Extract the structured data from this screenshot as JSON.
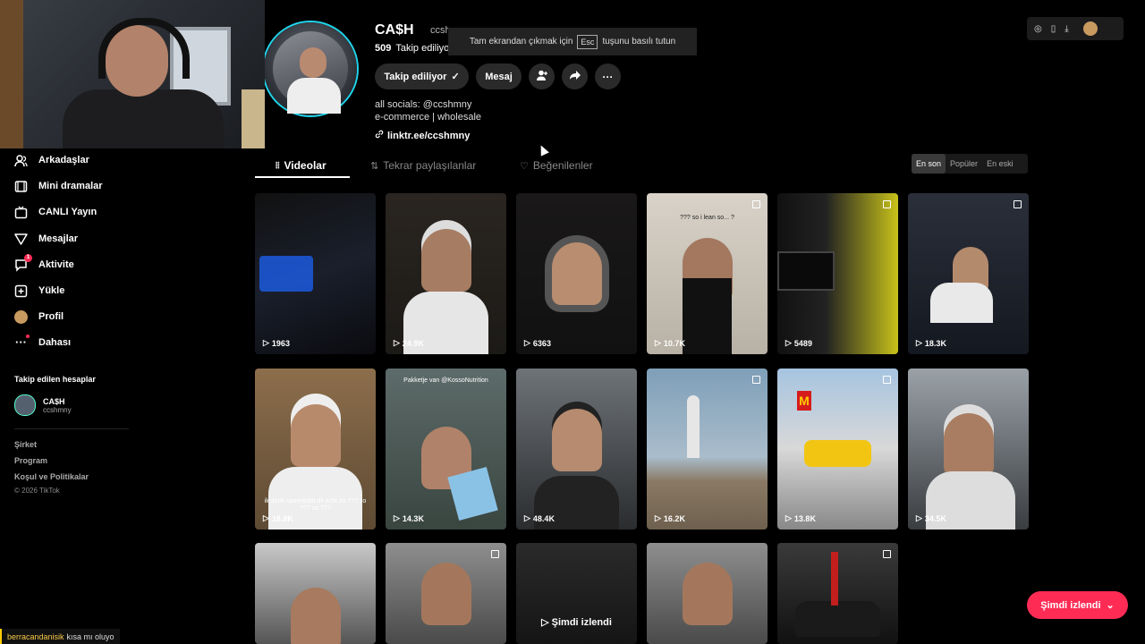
{
  "profile": {
    "name": "CA$H",
    "handle": "ccsh",
    "following_count": "509",
    "following_label": "Takip ediliyo",
    "buttons": {
      "following": "Takip ediliyor",
      "message": "Mesaj"
    },
    "bio_line1": "all socials: @ccshmny",
    "bio_line2": "e-commerce | wholesale",
    "link": "linktr.ee/ccshmny"
  },
  "toast": {
    "before": "Tam ekrandan çıkmak için",
    "key": "Esc",
    "after": "tuşunu basılı tutun"
  },
  "sidebar": {
    "items": [
      {
        "label": "Arkadaşlar",
        "icon": "friends-icon"
      },
      {
        "label": "Mini dramalar",
        "icon": "mini-drama-icon"
      },
      {
        "label": "CANLI Yayın",
        "icon": "live-icon"
      },
      {
        "label": "Mesajlar",
        "icon": "messages-icon"
      },
      {
        "label": "Aktivite",
        "icon": "activity-icon",
        "badge": "1"
      },
      {
        "label": "Yükle",
        "icon": "upload-icon"
      },
      {
        "label": "Profil",
        "icon": "profile-icon"
      },
      {
        "label": "Dahası",
        "icon": "more-icon"
      }
    ],
    "following_title": "Takip edilen hesaplar",
    "account": {
      "name": "CA$H",
      "handle": "ccshmny"
    },
    "footer": [
      "Şirket",
      "Program",
      "Koşul ve Politikalar"
    ],
    "copyright": "© 2026 TikTok"
  },
  "tabs": [
    {
      "label": "Videolar",
      "icon": "grid-icon"
    },
    {
      "label": "Tekrar paylaşılanlar",
      "icon": "repost-icon"
    },
    {
      "label": "Beğenilenler",
      "icon": "liked-icon"
    }
  ],
  "sort": [
    "En son",
    "Popüler",
    "En eski"
  ],
  "videos": [
    {
      "plays": "1963",
      "multi": false
    },
    {
      "plays": "24.9K",
      "multi": false
    },
    {
      "plays": "6363",
      "multi": false
    },
    {
      "plays": "10.7K",
      "multi": true,
      "caption": "??? so i lean so... ?"
    },
    {
      "plays": "5489",
      "multi": true
    },
    {
      "plays": "18.3K",
      "multi": true
    },
    {
      "plays": "18.8K",
      "multi": false,
      "caption": "ik denk opeenkdat dit echt zo ??? zo ??? zo ???"
    },
    {
      "plays": "14.3K",
      "multi": false,
      "caption": "Pakketje van @KossoNutrition"
    },
    {
      "plays": "48.4K",
      "multi": false
    },
    {
      "plays": "16.2K",
      "multi": true
    },
    {
      "plays": "13.8K",
      "multi": true
    },
    {
      "plays": "34.5K",
      "multi": false
    },
    {
      "plays": "",
      "multi": false
    },
    {
      "plays": "",
      "multi": true
    },
    {
      "plays": "",
      "multi": false,
      "now_watched": "Şimdi izlendi"
    },
    {
      "plays": "",
      "multi": false
    },
    {
      "plays": "",
      "multi": true
    }
  ],
  "watch_button": "Şimdi izlendi",
  "chat": {
    "user": "berracandanisik",
    "message": "kısa mı oluyo"
  },
  "colors": {
    "accent": "#fe2c55",
    "ring": "#20d5ec"
  }
}
